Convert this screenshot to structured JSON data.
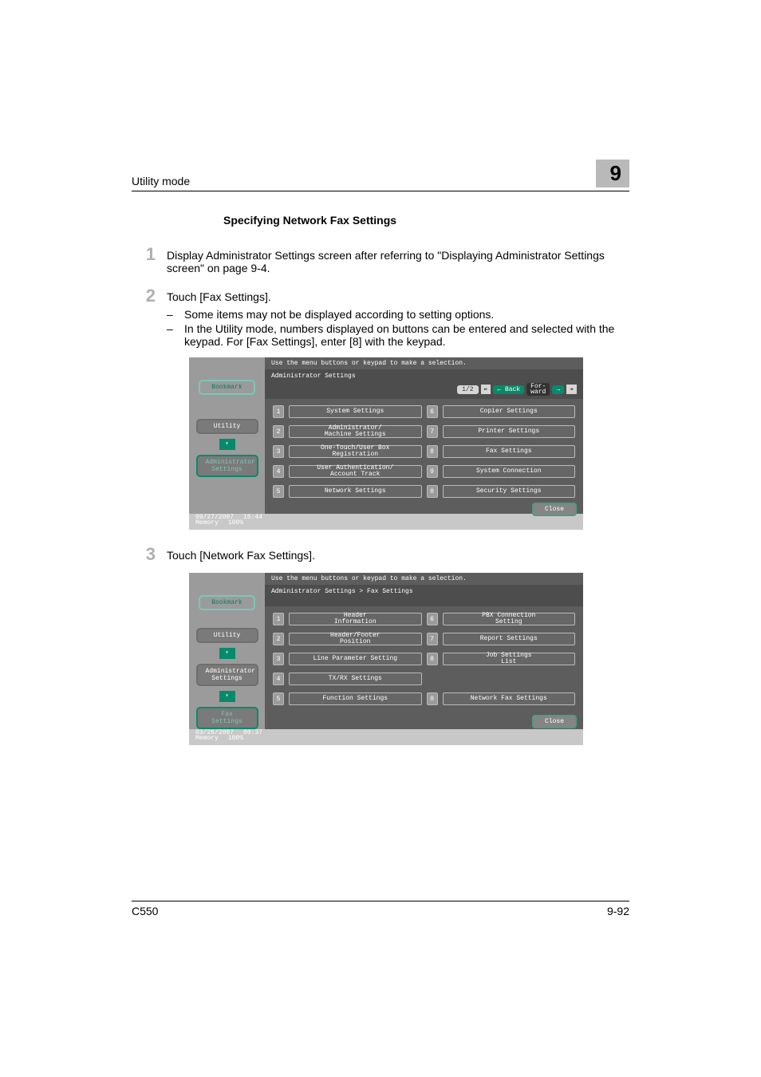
{
  "header": {
    "left": "Utility mode",
    "chapter": "9"
  },
  "section_title": "Specifying Network Fax Settings",
  "steps": {
    "s1": {
      "num": "1",
      "text": "Display Administrator Settings screen after referring to \"Displaying Administrator Settings screen\" on page 9-4."
    },
    "s2": {
      "num": "2",
      "text": "Touch [Fax Settings].",
      "b1": "Some items may not be displayed according to setting options.",
      "b2": "In the Utility mode, numbers displayed on buttons can be entered and selected with the keypad. For [Fax Settings], enter [8] with the keypad."
    },
    "s3": {
      "num": "3",
      "text": "Touch [Network Fax Settings]."
    }
  },
  "ss_common": {
    "hint": "Use the menu buttons or keypad to make a selection.",
    "bookmark": "Bookmark",
    "utility": "Utility",
    "admin": "Administrator\nSettings",
    "faxset": "Fax Settings",
    "close": "Close"
  },
  "ss1": {
    "breadcrumb": "Administrator Settings",
    "pager": "1/2",
    "back": "← Back",
    "fwd_label": "For-\nward",
    "fwd_arrow": "→",
    "opts": {
      "n1": "1",
      "l1": "System Settings",
      "n6": "6",
      "l6": "Copier Settings",
      "n2": "2",
      "l2": "Administrator/\nMachine Settings",
      "n7": "7",
      "l7": "Printer Settings",
      "n3": "3",
      "l3": "One-Touch/User Box\nRegistration",
      "n8": "8",
      "l8": "Fax Settings",
      "n4": "4",
      "l4": "User Authentication/\nAccount Track",
      "n9": "9",
      "l9": "System Connection",
      "n5": "5",
      "l5": "Network Settings",
      "n0": "0",
      "l0": "Security Settings"
    },
    "date": "09/27/2007",
    "time": "15:44",
    "mem": "Memory",
    "mempct": "100%"
  },
  "ss2": {
    "breadcrumb": "Administrator Settings  > Fax Settings",
    "opts": {
      "n1": "1",
      "l1": "Header\nInformation",
      "n6": "6",
      "l6": "PBX Connection\nSetting",
      "n2": "2",
      "l2": "Header/Footer\nPosition",
      "n7": "7",
      "l7": "Report Settings",
      "n3": "3",
      "l3": "Line Parameter Setting",
      "n8": "8",
      "l8": "Job Settings\nList",
      "n4": "4",
      "l4": "TX/RX Settings",
      "n9": "",
      "l9": "",
      "n5": "5",
      "l5": "Function Settings",
      "n0": "0",
      "l0": "Network Fax Settings"
    },
    "date": "03/26/2007",
    "time": "00:37",
    "mem": "Memory",
    "mempct": "100%"
  },
  "footer": {
    "left": "C550",
    "right": "9-92"
  }
}
